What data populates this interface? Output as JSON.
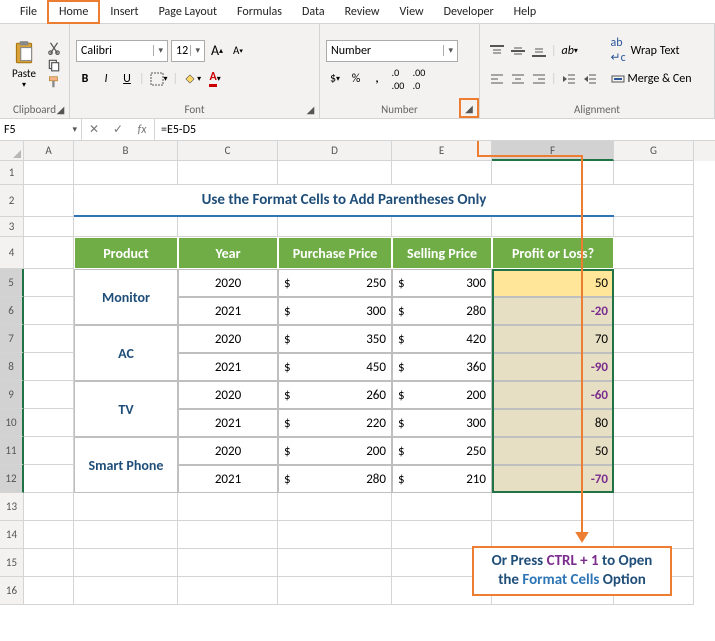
{
  "menu": {
    "file": "File",
    "home": "Home",
    "insert": "Insert",
    "page": "Page Layout",
    "formulas": "Formulas",
    "data": "Data",
    "review": "Review",
    "view": "View",
    "developer": "Developer",
    "help": "Help"
  },
  "ribbon": {
    "paste": "Paste",
    "font_name": "Calibri",
    "font_size": "12",
    "number_format": "Number",
    "wrap": "Wrap Text",
    "merge": "Merge & Cen",
    "g_clip": "Clipboard",
    "g_font": "Font",
    "g_num": "Number",
    "g_align": "Alignment",
    "bold": "B",
    "italic": "I",
    "underline": "U"
  },
  "fb": {
    "name": "F5",
    "fx": "fx",
    "formula": "=E5-D5",
    "cancel": "✕",
    "enter": "✓"
  },
  "cols": {
    "A": "A",
    "B": "B",
    "C": "C",
    "D": "D",
    "E": "E",
    "F": "F",
    "G": "G"
  },
  "title": "Use the Format Cells to Add Parentheses Only",
  "hdr": {
    "product": "Product",
    "year": "Year",
    "pp": "Purchase Price",
    "sp": "Selling Price",
    "pl": "Profit or Loss?"
  },
  "prod": {
    "monitor": "Monitor",
    "ac": "AC",
    "tv": "TV",
    "sp": "Smart Phone"
  },
  "rows": [
    {
      "y": "2020",
      "pp": "250",
      "sp": "300",
      "pl": "50"
    },
    {
      "y": "2021",
      "pp": "300",
      "sp": "280",
      "pl": "-20"
    },
    {
      "y": "2020",
      "pp": "350",
      "sp": "420",
      "pl": "70"
    },
    {
      "y": "2021",
      "pp": "450",
      "sp": "360",
      "pl": "-90"
    },
    {
      "y": "2020",
      "pp": "260",
      "sp": "200",
      "pl": "-60"
    },
    {
      "y": "2021",
      "pp": "220",
      "sp": "300",
      "pl": "80"
    },
    {
      "y": "2020",
      "pp": "200",
      "sp": "250",
      "pl": "50"
    },
    {
      "y": "2021",
      "pp": "280",
      "sp": "210",
      "pl": "-70"
    }
  ],
  "dollar": "$",
  "annot": {
    "l1a": "Or Press ",
    "ctrl": "CTRL + 1",
    "l1b": " to Open",
    "l2a": "the ",
    "fc": "Format Cells",
    "l2b": " Option"
  }
}
